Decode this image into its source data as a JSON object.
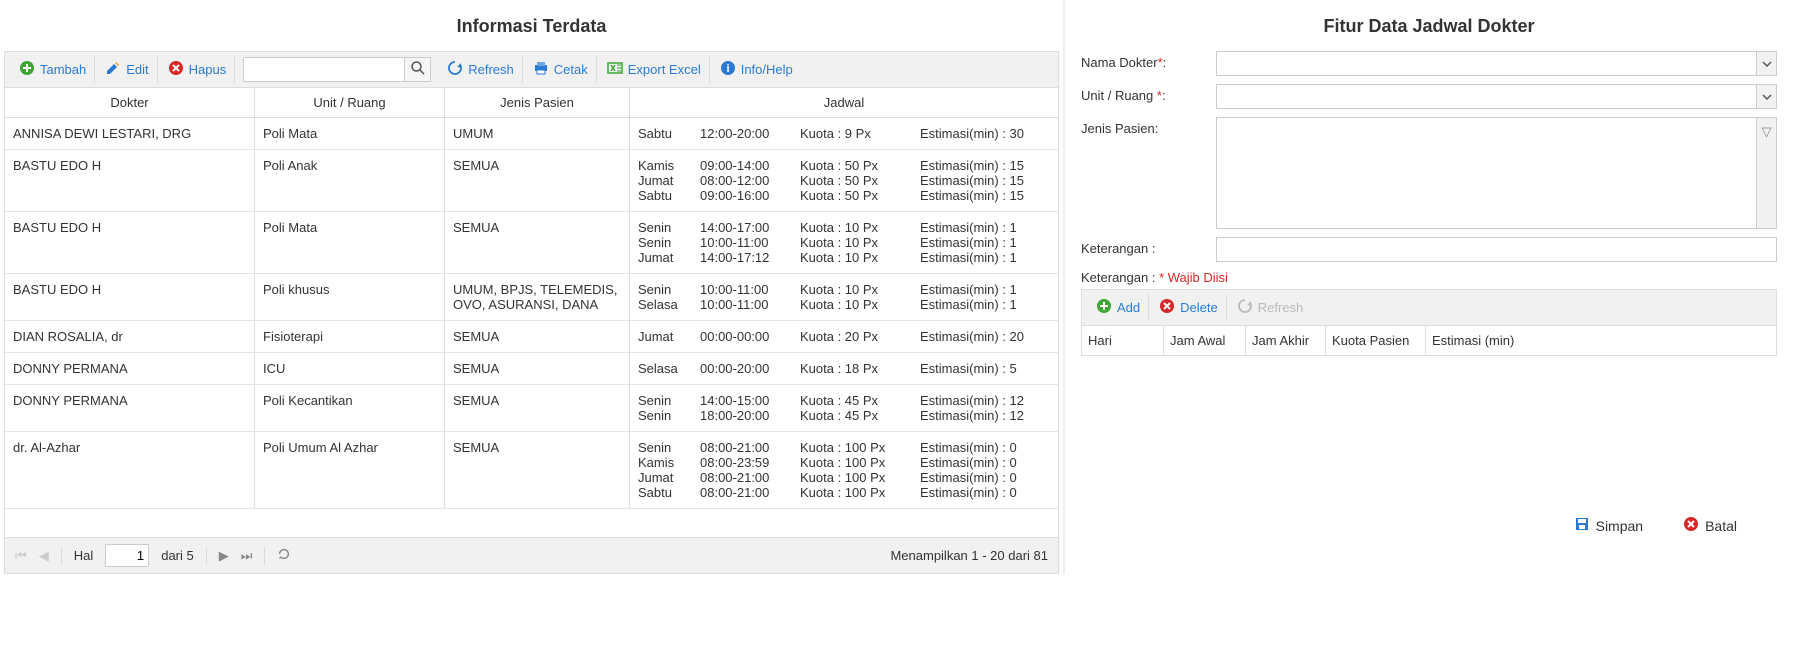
{
  "left": {
    "title": "Informasi Terdata",
    "toolbar": {
      "tambah": "Tambah",
      "edit": "Edit",
      "hapus": "Hapus",
      "search_placeholder": "",
      "refresh": "Refresh",
      "cetak": "Cetak",
      "export": "Export Excel",
      "info": "Info/Help"
    },
    "columns": {
      "dokter": "Dokter",
      "unit": "Unit / Ruang",
      "jenis": "Jenis Pasien",
      "jadwal": "Jadwal"
    },
    "rows": [
      {
        "dokter": "ANNISA DEWI LESTARI, DRG",
        "unit": "Poli Mata",
        "jenis": "UMUM",
        "schedules": [
          {
            "day": "Sabtu",
            "time": "12:00-20:00",
            "quota": "Kuota : 9 Px",
            "est": "Estimasi(min) : 30"
          }
        ]
      },
      {
        "dokter": "BASTU EDO H",
        "unit": "Poli Anak",
        "jenis": "SEMUA",
        "schedules": [
          {
            "day": "Kamis",
            "time": "09:00-14:00",
            "quota": "Kuota : 50 Px",
            "est": "Estimasi(min) : 15"
          },
          {
            "day": "Jumat",
            "time": "08:00-12:00",
            "quota": "Kuota : 50 Px",
            "est": "Estimasi(min) : 15"
          },
          {
            "day": "Sabtu",
            "time": "09:00-16:00",
            "quota": "Kuota : 50 Px",
            "est": "Estimasi(min) : 15"
          }
        ]
      },
      {
        "dokter": "BASTU EDO H",
        "unit": "Poli Mata",
        "jenis": "SEMUA",
        "schedules": [
          {
            "day": "Senin",
            "time": "14:00-17:00",
            "quota": "Kuota : 10 Px",
            "est": "Estimasi(min) : 1"
          },
          {
            "day": "Senin",
            "time": "10:00-11:00",
            "quota": "Kuota : 10 Px",
            "est": "Estimasi(min) : 1"
          },
          {
            "day": "Jumat",
            "time": "14:00-17:12",
            "quota": "Kuota : 10 Px",
            "est": "Estimasi(min) : 1"
          }
        ]
      },
      {
        "dokter": "BASTU EDO H",
        "unit": "Poli khusus",
        "jenis": "UMUM, BPJS, TELEMEDIS, OVO, ASURANSI, DANA",
        "schedules": [
          {
            "day": "Senin",
            "time": "10:00-11:00",
            "quota": "Kuota : 10 Px",
            "est": "Estimasi(min) : 1"
          },
          {
            "day": "Selasa",
            "time": "10:00-11:00",
            "quota": "Kuota : 10 Px",
            "est": "Estimasi(min) : 1"
          }
        ]
      },
      {
        "dokter": "DIAN ROSALIA, dr",
        "unit": "Fisioterapi",
        "jenis": "SEMUA",
        "schedules": [
          {
            "day": "Jumat",
            "time": "00:00-00:00",
            "quota": "Kuota : 20 Px",
            "est": "Estimasi(min) : 20"
          }
        ]
      },
      {
        "dokter": "DONNY PERMANA",
        "unit": "ICU",
        "jenis": "SEMUA",
        "schedules": [
          {
            "day": "Selasa",
            "time": "00:00-20:00",
            "quota": "Kuota : 18 Px",
            "est": "Estimasi(min) : 5"
          }
        ]
      },
      {
        "dokter": "DONNY PERMANA",
        "unit": "Poli Kecantikan",
        "jenis": "SEMUA",
        "schedules": [
          {
            "day": "Senin",
            "time": "14:00-15:00",
            "quota": "Kuota : 45 Px",
            "est": "Estimasi(min) : 12"
          },
          {
            "day": "Senin",
            "time": "18:00-20:00",
            "quota": "Kuota : 45 Px",
            "est": "Estimasi(min) : 12"
          }
        ]
      },
      {
        "dokter": "dr. Al-Azhar",
        "unit": "Poli Umum Al Azhar",
        "jenis": "SEMUA",
        "schedules": [
          {
            "day": "Senin",
            "time": "08:00-21:00",
            "quota": "Kuota : 100 Px",
            "est": "Estimasi(min) : 0"
          },
          {
            "day": "Kamis",
            "time": "08:00-23:59",
            "quota": "Kuota : 100 Px",
            "est": "Estimasi(min) : 0"
          },
          {
            "day": "Jumat",
            "time": "08:00-21:00",
            "quota": "Kuota : 100 Px",
            "est": "Estimasi(min) : 0"
          },
          {
            "day": "Sabtu",
            "time": "08:00-21:00",
            "quota": "Kuota : 100 Px",
            "est": "Estimasi(min) : 0"
          }
        ]
      }
    ],
    "pager": {
      "hal": "Hal",
      "page": "1",
      "dari": "dari 5",
      "status": "Menampilkan 1 - 20 dari 81"
    }
  },
  "right": {
    "title": "Fitur Data Jadwal Dokter",
    "labels": {
      "nama_dokter": "Nama Dokter",
      "unit": "Unit / Ruang ",
      "jenis": "Jenis Pasien:",
      "keterangan": "Keterangan :",
      "note_prefix": "Keterangan : ",
      "note_req": "* Wajib Diisi"
    },
    "sub_toolbar": {
      "add": "Add",
      "delete": "Delete",
      "refresh": "Refresh"
    },
    "sub_columns": {
      "hari": "Hari",
      "jam_awal": "Jam Awal",
      "jam_akhir": "Jam Akhir",
      "kuota": "Kuota Pasien",
      "estimasi": "Estimasi (min)"
    },
    "actions": {
      "simpan": "Simpan",
      "batal": "Batal"
    }
  }
}
